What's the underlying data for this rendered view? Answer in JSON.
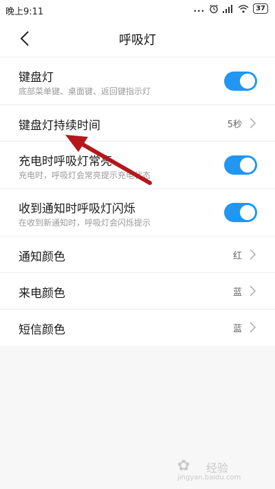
{
  "status_bar": {
    "time": "晚上9:11",
    "dots": "...",
    "battery": "37"
  },
  "header": {
    "title": "呼吸灯"
  },
  "rows": [
    {
      "title": "键盘灯",
      "subtitle": "底部菜单键、桌面键、返回键指示灯",
      "toggle_on": true
    },
    {
      "title": "键盘灯持续时间",
      "value": "5秒"
    },
    {
      "title": "充电时呼吸灯常亮",
      "subtitle": "充电时，呼吸灯会常亮提示充电状态",
      "toggle_on": true
    },
    {
      "title": "收到通知时呼吸灯闪烁",
      "subtitle": "在收到新通知时，呼吸灯会闪烁提示",
      "toggle_on": true
    },
    {
      "title": "通知颜色",
      "value": "红"
    },
    {
      "title": "来电颜色",
      "value": "蓝"
    },
    {
      "title": "短信颜色",
      "value": "蓝"
    }
  ],
  "watermark": {
    "logo": "Baidu",
    "text": "经验",
    "url": "jingyan.baidu.com"
  },
  "colors": {
    "accent": "#2196f3",
    "annotation": "#b5171d"
  }
}
